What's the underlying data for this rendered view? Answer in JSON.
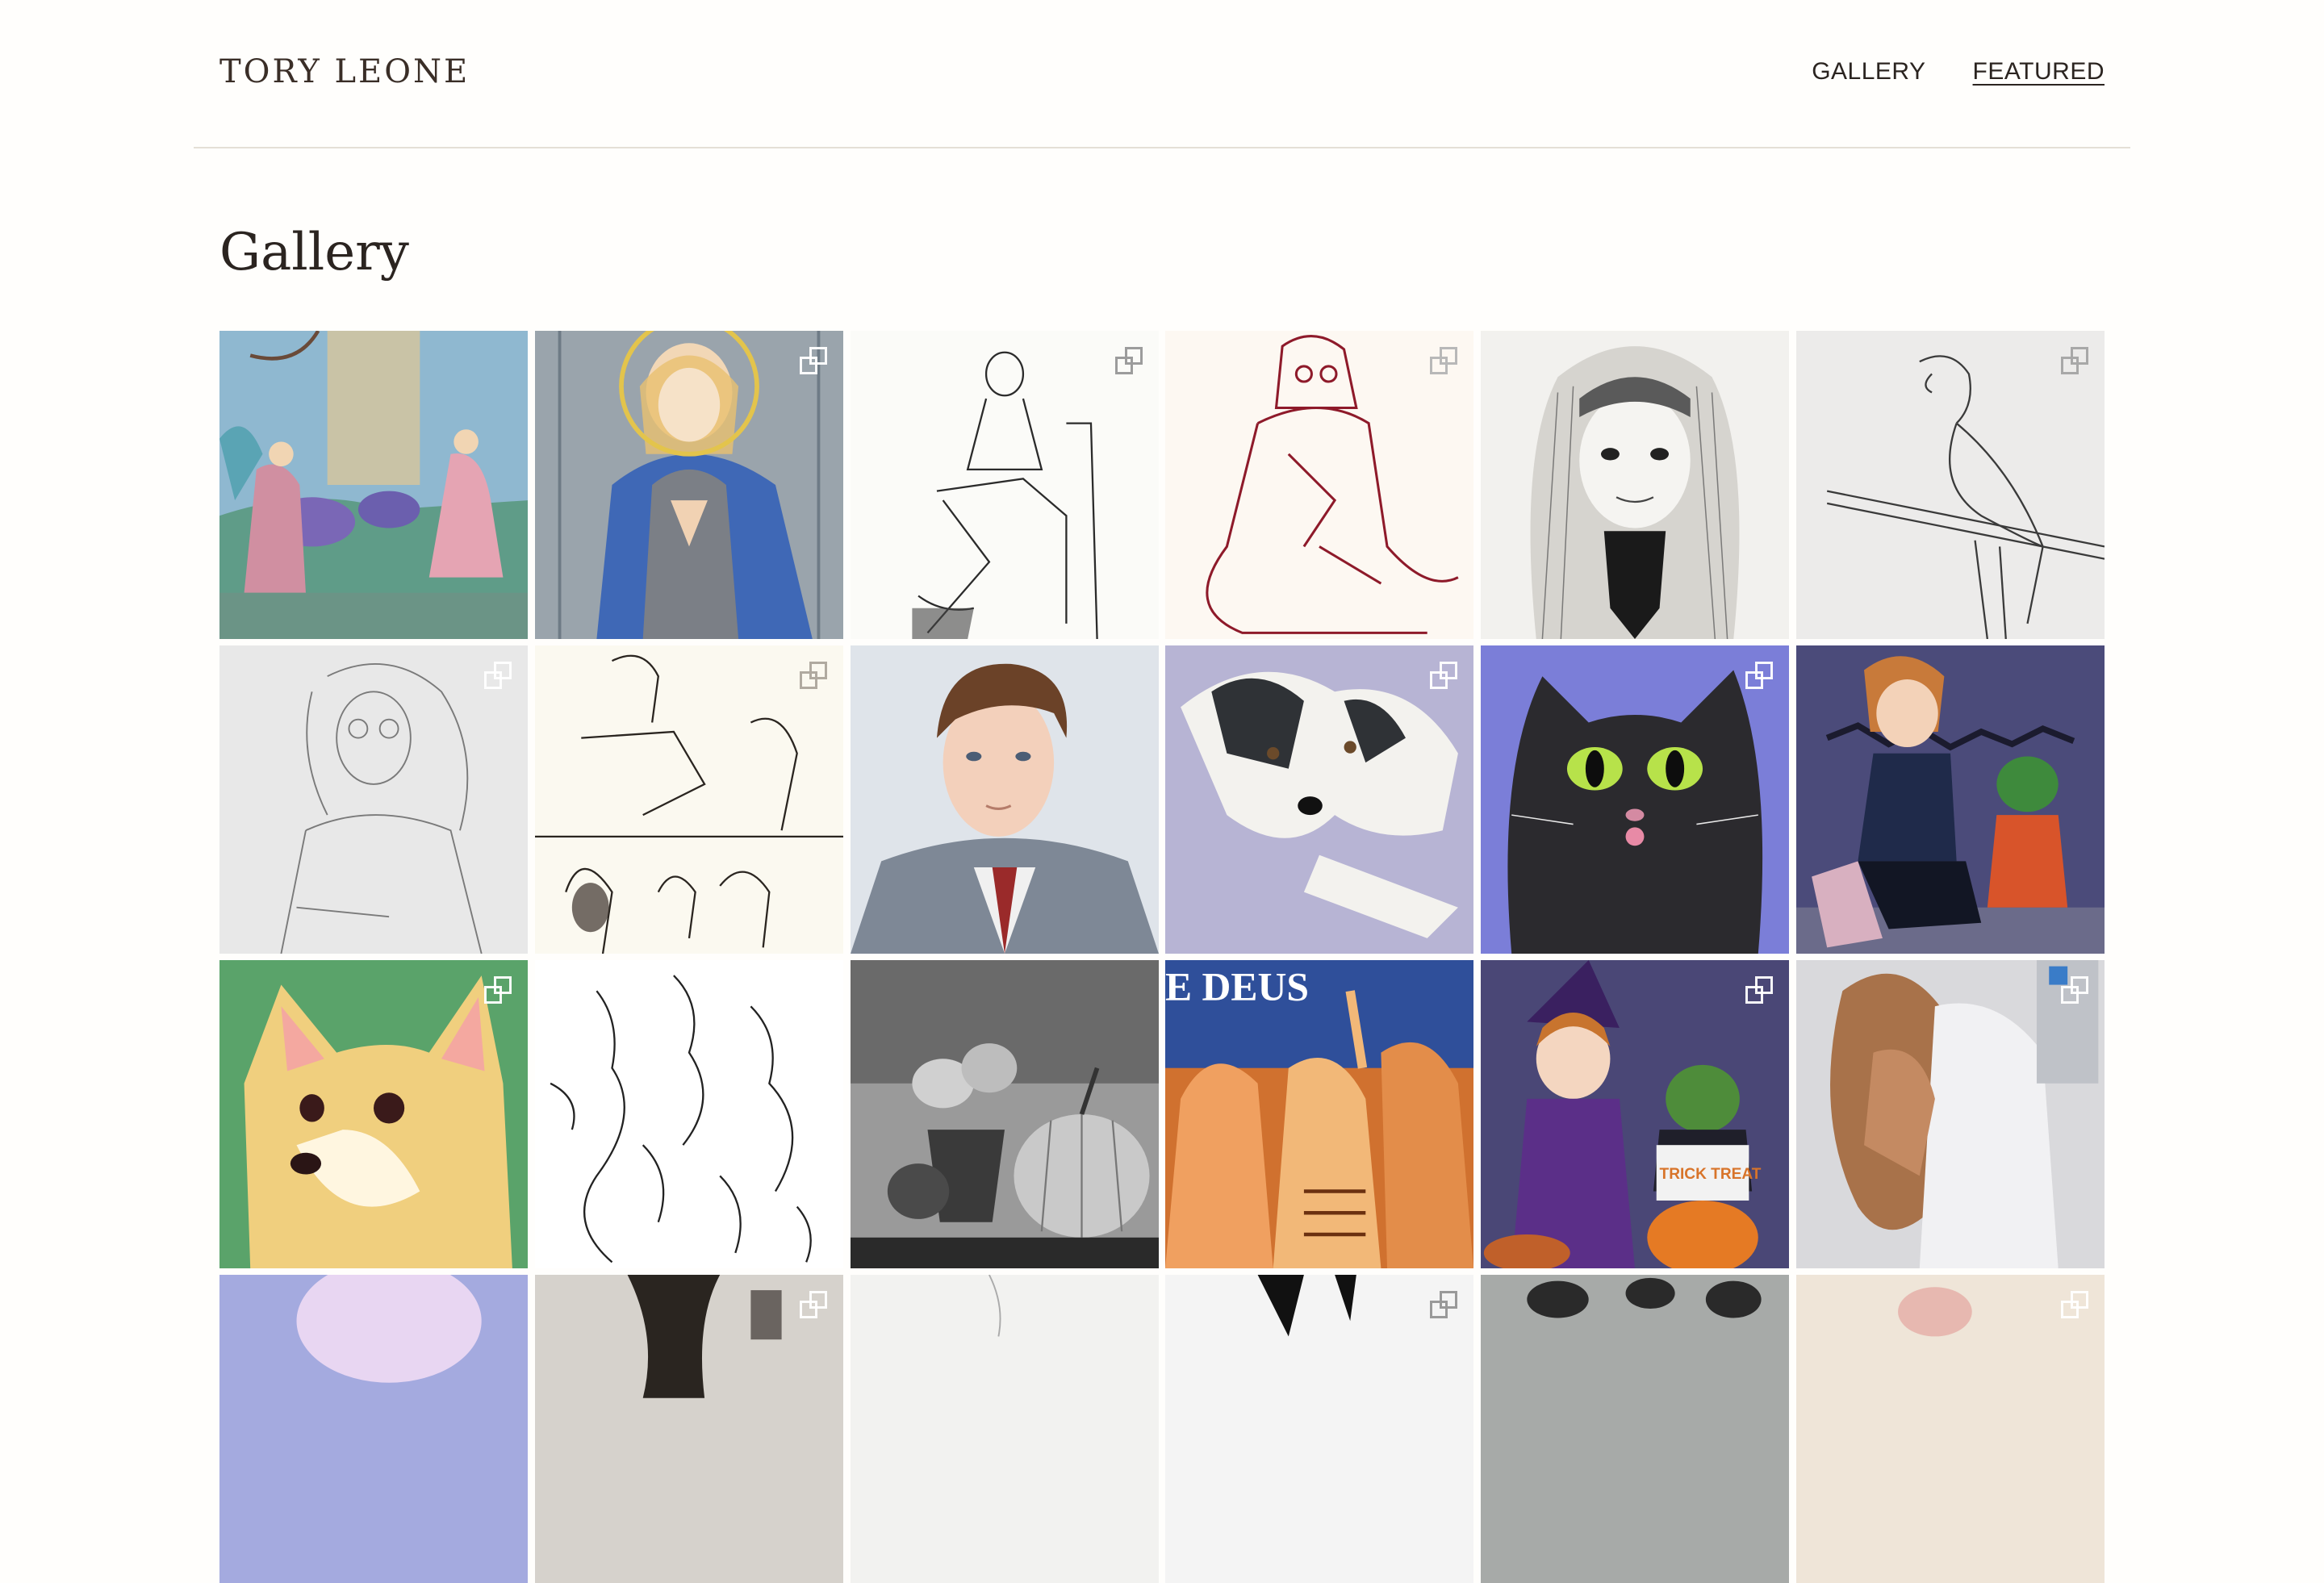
{
  "header": {
    "site_title": "TORY LEONE",
    "nav": [
      {
        "label": "GALLERY",
        "active": false
      },
      {
        "label": "FEATURED",
        "active": true
      }
    ]
  },
  "main": {
    "title": "Gallery",
    "tiles": [
      {
        "subject": "annunciation watercolor painting",
        "bg": "#8fb8d0",
        "multi": false
      },
      {
        "subject": "madonna praying watercolor",
        "bg": "#8c9aa6",
        "multi": true
      },
      {
        "subject": "man seated ink sketch",
        "bg": "#fbfbf8",
        "multi": true
      },
      {
        "subject": "red ink nun sketch",
        "bg": "#fdf8f2",
        "multi": true
      },
      {
        "subject": "girl portrait pencil drawing",
        "bg": "#f2f1ee",
        "multi": false
      },
      {
        "subject": "parrot pencil sketch",
        "bg": "#ecebea",
        "multi": true
      },
      {
        "subject": "curly-haired woman pencil sketch",
        "bg": "#e8e8e8",
        "multi": true
      },
      {
        "subject": "figure study ink sketches",
        "bg": "#fbf9f0",
        "multi": true
      },
      {
        "subject": "young man portrait watercolor",
        "bg": "#dfe4ea",
        "multi": false
      },
      {
        "subject": "border collie watercolor",
        "bg": "#b7b4d4",
        "multi": true
      },
      {
        "subject": "black cat with green eyes",
        "bg": "#7b7ed8",
        "multi": true
      },
      {
        "subject": "halloween girl with pepe digital art",
        "bg": "#4b4b7a",
        "multi": false
      },
      {
        "subject": "doge shiba digital art",
        "bg": "#5aa36a",
        "multi": true
      },
      {
        "subject": "mermaids ink line art",
        "bg": "#ffffff",
        "multi": false
      },
      {
        "subject": "pumpkins charcoal still life",
        "bg": "#9a9a9a",
        "multi": false
      },
      {
        "subject": "dancing crowd orange poster",
        "bg": "#d0712f",
        "multi": false
      },
      {
        "subject": "witch and pepe trick or treat",
        "bg": "#4a4776",
        "multi": true
      },
      {
        "subject": "embracing figures watercolor",
        "bg": "#d9d9dc",
        "multi": true
      },
      {
        "subject": "lavender hair figure",
        "bg": "#a4aadf",
        "multi": false
      },
      {
        "subject": "woman phone sketch",
        "bg": "#d6d2cc",
        "multi": true
      },
      {
        "subject": "faint pencil figure",
        "bg": "#f2f2f0",
        "multi": false
      },
      {
        "subject": "black and white figure",
        "bg": "#f4f4f4",
        "multi": true
      },
      {
        "subject": "penguins dark sketch",
        "bg": "#a7aaa8",
        "multi": false
      },
      {
        "subject": "pink pig sketch",
        "bg": "#efe5d8",
        "multi": true
      }
    ],
    "poster_text": "E DEUS",
    "trick_text": "TRICK TREAT"
  }
}
